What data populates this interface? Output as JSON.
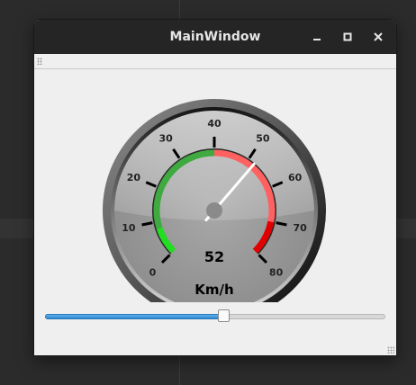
{
  "window": {
    "title": "MainWindow"
  },
  "gauge": {
    "value": 52,
    "value_text": "52",
    "unit": "Km/h",
    "min": 0,
    "max": 80,
    "ticks": [
      "0",
      "10",
      "20",
      "30",
      "40",
      "50",
      "60",
      "70",
      "80"
    ],
    "colors": {
      "low_band": "#22dd22",
      "mid_band": "#3faa3f",
      "high_band": "#ff6161",
      "red_band": "#e00000",
      "needle": "#ffffff"
    }
  },
  "slider": {
    "value_fraction": 0.525
  }
}
